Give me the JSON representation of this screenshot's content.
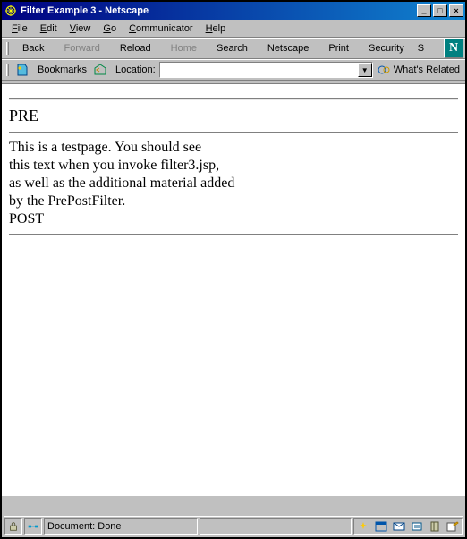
{
  "window": {
    "title": "Filter Example 3 - Netscape"
  },
  "menu": {
    "file": "File",
    "edit": "Edit",
    "view": "View",
    "go": "Go",
    "communicator": "Communicator",
    "help": "Help"
  },
  "toolbar": {
    "back": "Back",
    "forward": "Forward",
    "reload": "Reload",
    "home": "Home",
    "search": "Search",
    "netscape": "Netscape",
    "print": "Print",
    "security": "Security",
    "shop": "S"
  },
  "location": {
    "bookmarks": "Bookmarks",
    "label": "Location:",
    "value": "",
    "related": "What's Related"
  },
  "page": {
    "heading": "PRE",
    "line1": "This is a testpage. You should see",
    "line2": "this text when you invoke filter3.jsp,",
    "line3": "as well as the additional material added",
    "line4": "by the PrePostFilter.",
    "line5": "POST"
  },
  "status": {
    "text": "Document: Done"
  }
}
